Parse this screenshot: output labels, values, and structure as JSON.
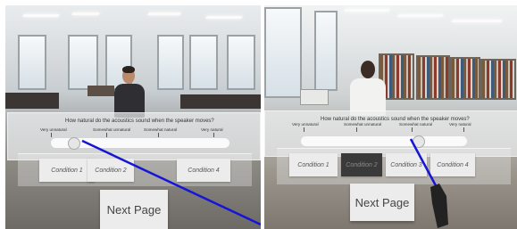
{
  "left_view": {
    "question": "How natural do the acoustics sound when the speaker moves?",
    "scale": [
      "Very unnatural",
      "Somewhat unnatural",
      "Somewhat natural",
      "Very natural"
    ],
    "conditions": [
      "Condition 1",
      "Condition 2",
      "Condition 4"
    ],
    "next_button": "Next Page",
    "slider_value": 0.1,
    "pointer_color": "#1515d6"
  },
  "right_view": {
    "question": "How natural do the acoustics sound when the speaker moves?",
    "scale": [
      "Very unnatural",
      "Somewhat unnatural",
      "Somewhat natural",
      "Very natural"
    ],
    "conditions": [
      "Condition 1",
      "Condition 2",
      "Condition 3",
      "Condition 4"
    ],
    "active_condition": "Condition 2",
    "next_button": "Next Page",
    "slider_value": 0.72,
    "pointer_color": "#1515d6"
  }
}
